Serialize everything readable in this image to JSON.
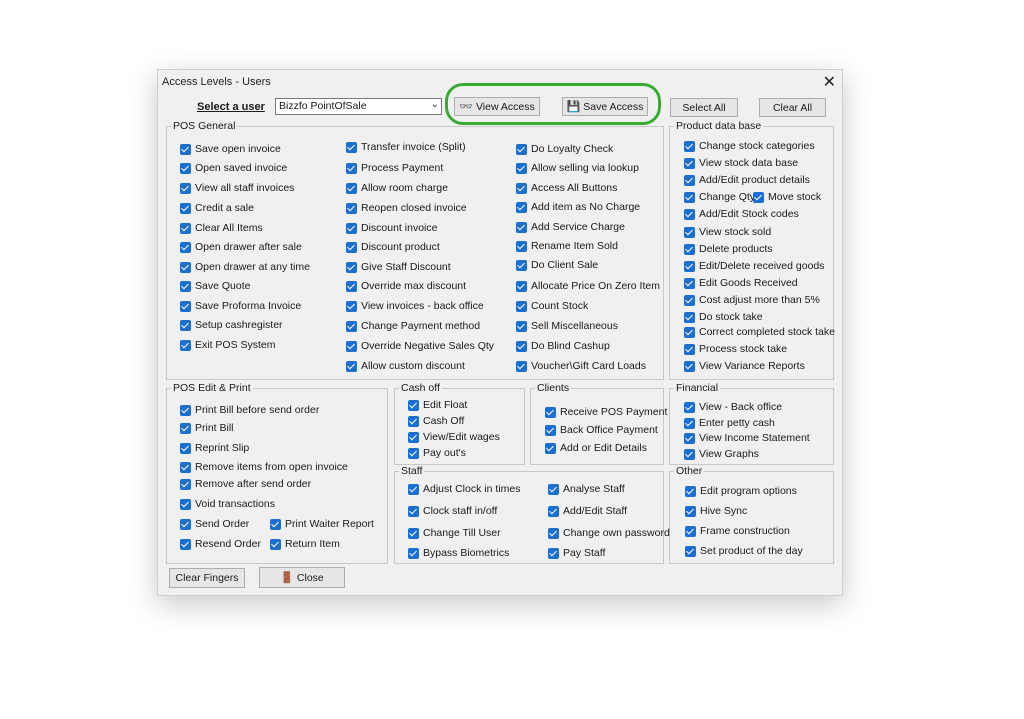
{
  "window": {
    "title": "Access Levels - Users"
  },
  "top": {
    "select_user_label": "Select a user",
    "user_value": "Bizzfo PointOfSale",
    "view_access": "View Access",
    "save_access": "Save Access",
    "select_all": "Select All",
    "clear_all": "Clear All"
  },
  "groups": {
    "pos_general": "POS General",
    "product_db": "Product data base",
    "pos_edit": "POS Edit & Print",
    "cash_off": "Cash off",
    "clients": "Clients",
    "financial": "Financial",
    "staff": "Staff",
    "other": "Other"
  },
  "pos_general": {
    "col1": [
      "Save open invoice",
      "Open saved invoice",
      "View all staff invoices",
      "Credit a sale",
      "Clear All Items",
      "Open drawer after sale",
      "Open drawer at any time",
      "Save Quote",
      "Save Proforma Invoice",
      "Setup cashregister",
      "Exit POS System"
    ],
    "col2": [
      "Transfer invoice (Split)",
      "Process Payment",
      "Allow room charge",
      "Reopen closed invoice",
      "Discount invoice",
      "Discount product",
      "Give Staff Discount",
      "Override max discount",
      "View invoices - back office",
      "Change Payment method",
      "Override Negative Sales Qty",
      "Allow custom discount"
    ],
    "col3": [
      "Do Loyalty Check",
      "Allow selling via lookup",
      "Access All Buttons",
      "Add item as No Charge",
      "Add Service Charge",
      "Rename Item Sold",
      "Do Client Sale",
      "Allocate Price On Zero Item",
      "Count Stock",
      "Sell Miscellaneous",
      "Do Blind Cashup",
      "Voucher\\Gift Card Loads"
    ]
  },
  "product_db": [
    "Change stock categories",
    "View stock data base",
    "Add/Edit product details",
    "Change Qty",
    "Move stock",
    "Add/Edit Stock codes",
    "View stock sold",
    "Delete products",
    "Edit/Delete received goods",
    "Edit Goods Received",
    "Cost adjust more than 5%",
    "Do stock take",
    "Correct completed  stock take",
    "Process stock take",
    "View Variance Reports"
  ],
  "pos_edit": [
    "Print Bill before send order",
    "Print Bill",
    "Reprint Slip",
    "Remove items from open invoice",
    "Remove after send order",
    "Void transactions",
    "Send Order",
    "Print Waiter Report",
    "Resend Order",
    "Return Item"
  ],
  "cash_off": [
    "Edit Float",
    "Cash Off",
    "View/Edit wages",
    "Pay out's"
  ],
  "clients": [
    "Receive POS Payment",
    "Back Office Payment",
    "Add or Edit Details"
  ],
  "financial": [
    "View - Back office",
    "Enter petty cash",
    "View Income Statement",
    "View Graphs"
  ],
  "staff": [
    "Adjust Clock in times",
    "Analyse Staff",
    "Clock staff in/off",
    "Add/Edit Staff",
    "Change Till User",
    "Change own password",
    "Bypass Biometrics",
    "Pay Staff"
  ],
  "other": [
    "Edit program options",
    "Hive Sync",
    "Frame construction",
    "Set product of the day"
  ],
  "bottom": {
    "clear_fingers": "Clear Fingers",
    "close": "Close"
  },
  "colors": {
    "checkbox": "#1a6fd1",
    "highlight": "#3aaa35"
  }
}
